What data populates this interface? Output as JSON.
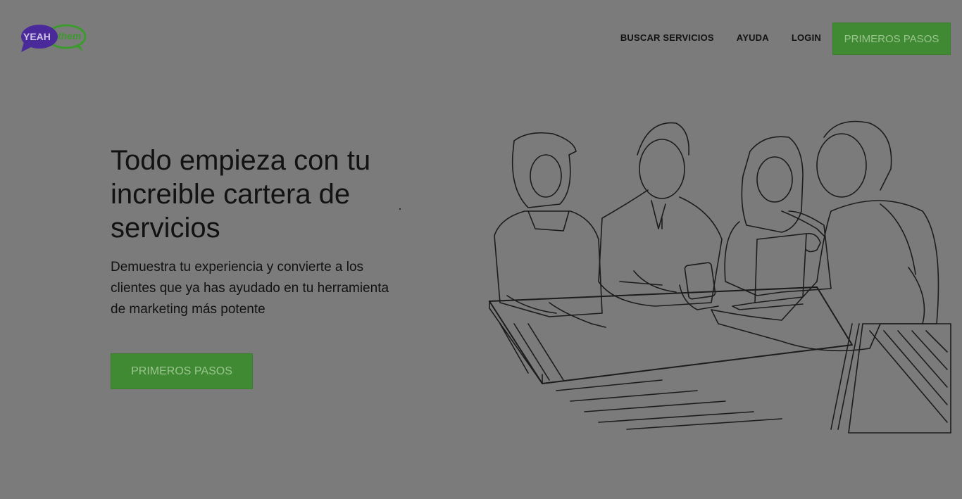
{
  "logo": {
    "text_left": "YEAH",
    "text_right": "them"
  },
  "nav": {
    "items": [
      {
        "label": "BUSCAR SERVICIOS"
      },
      {
        "label": "AYUDA"
      },
      {
        "label": "LOGIN"
      }
    ],
    "cta_label": "PRIMEROS PASOS"
  },
  "hero": {
    "title": "Todo empieza con tu increible cartera de servicios",
    "subtitle": "Demuestra tu experiencia y convierte a los clientes que ya has ayudado en tu herramienta de marketing más potente",
    "cta_label": "PRIMEROS PASOS"
  },
  "colors": {
    "overlay_background": "#7b7b7b",
    "cta_green": "#3f8a32",
    "logo_purple": "#4a2a9a",
    "logo_green": "#3c9a2e"
  },
  "illustration": {
    "icon": "people-meeting-illustration"
  }
}
